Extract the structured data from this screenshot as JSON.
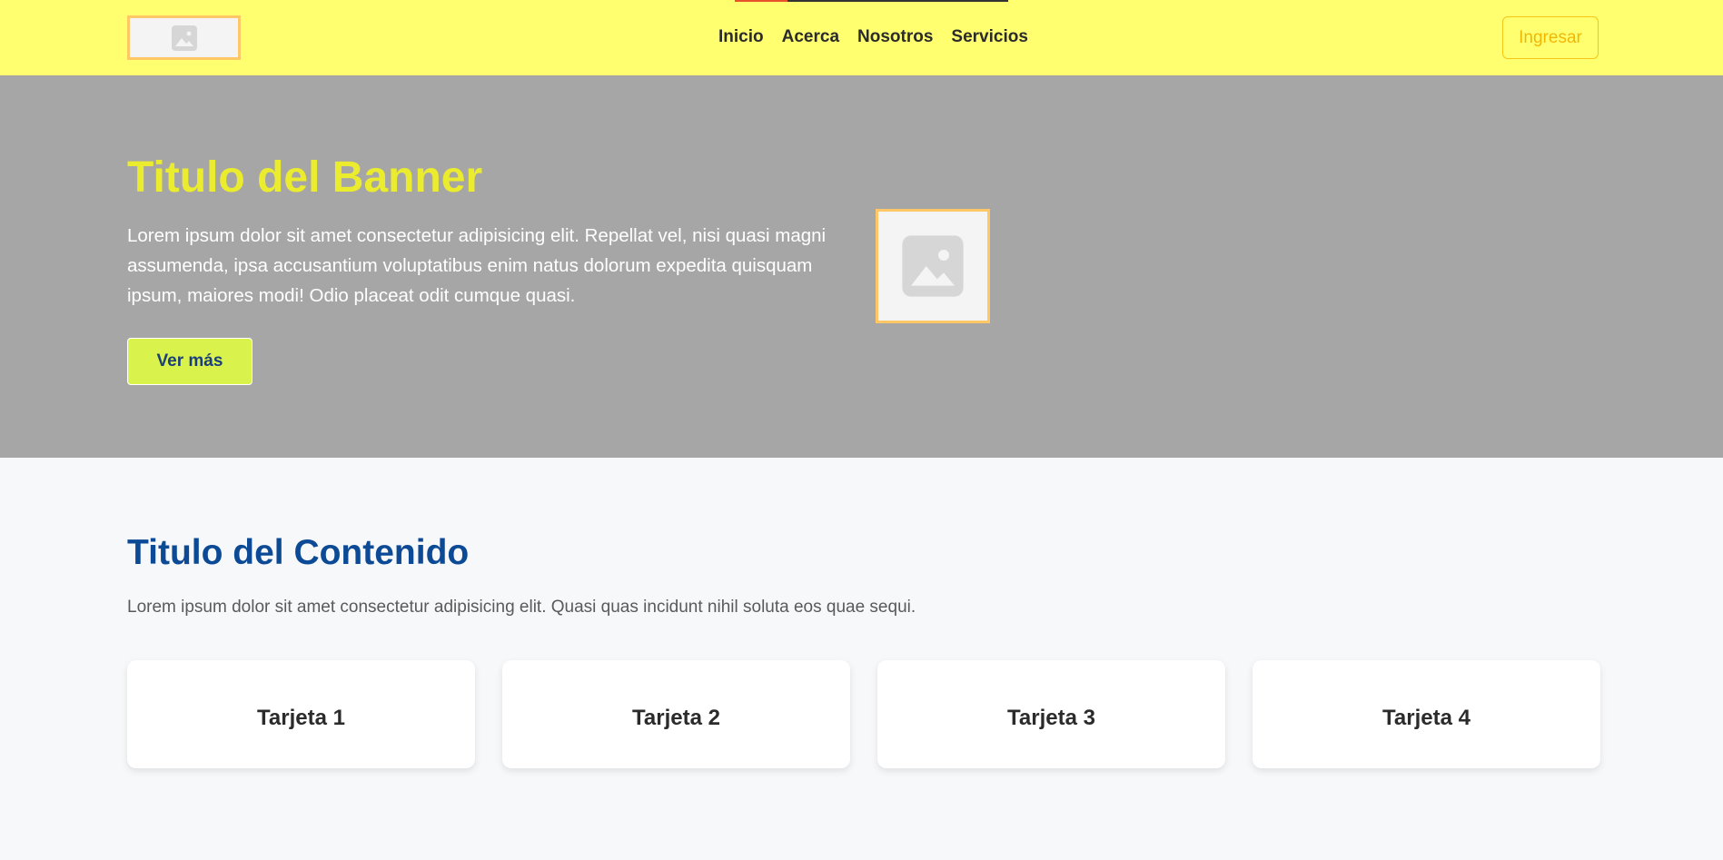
{
  "header": {
    "logo_icon": "image-placeholder-icon",
    "nav": [
      {
        "label": "Inicio"
      },
      {
        "label": "Acerca"
      },
      {
        "label": "Nosotros"
      },
      {
        "label": "Servicios"
      }
    ],
    "login_label": "Ingresar"
  },
  "hero": {
    "title": "Titulo del Banner",
    "text": "Lorem ipsum dolor sit amet consectetur adipisicing elit. Repellat vel, nisi quasi magni assumenda, ipsa accusantium voluptatibus enim natus dolorum expedita quisquam ipsum, maiores modi! Odio placeat odit cumque quasi.",
    "button_label": "Ver más",
    "image_icon": "image-placeholder-icon"
  },
  "content": {
    "title": "Titulo del Contenido",
    "text": "Lorem ipsum dolor sit amet consectetur adipisicing elit. Quasi quas incidunt nihil soluta eos quae sequi.",
    "cards": [
      {
        "title": "Tarjeta 1"
      },
      {
        "title": "Tarjeta 2"
      },
      {
        "title": "Tarjeta 3"
      },
      {
        "title": "Tarjeta 4"
      }
    ]
  },
  "colors": {
    "header_bg": "#ffff70",
    "hero_bg": "#a6a6a6",
    "hero_title": "#ecec2e",
    "hero_button_bg": "#d9f24c",
    "content_title": "#0d4a96",
    "login_accent": "#f2b705",
    "image_border": "#ffc766"
  }
}
